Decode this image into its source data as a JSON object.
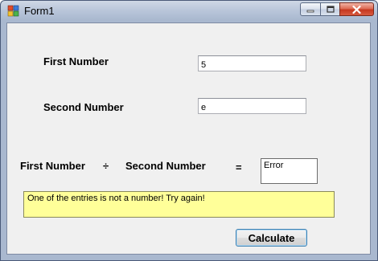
{
  "window": {
    "title": "Form1",
    "icon": "form-app-icon"
  },
  "form": {
    "first_label": "First Number",
    "first_value": "5",
    "second_label": "Second Number",
    "second_value": "e",
    "equation": {
      "left": "First Number",
      "operator": "÷",
      "right": "Second Number",
      "equals": "="
    },
    "result": "Error",
    "message": "One of the entries is not a number! Try again!",
    "calculate_label": "Calculate"
  },
  "colors": {
    "message_bg": "#ffff99",
    "form_bg": "#f0f0f0",
    "close_button": "#c6381f"
  }
}
